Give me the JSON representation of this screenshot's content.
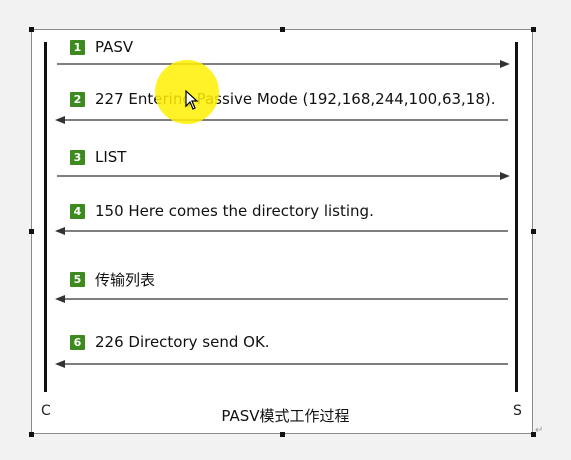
{
  "steps": [
    {
      "num": "1",
      "text": "PASV",
      "dir": "right"
    },
    {
      "num": "2",
      "text": "227 Entering Passive Mode (192,168,244,100,63,18).",
      "dir": "left"
    },
    {
      "num": "3",
      "text": "LIST",
      "dir": "right"
    },
    {
      "num": "4",
      "text": "150 Here comes the directory listing.",
      "dir": "left"
    },
    {
      "num": "5",
      "text": "传输列表",
      "dir": "left"
    },
    {
      "num": "6",
      "text": "226 Directory send OK.",
      "dir": "left"
    }
  ],
  "client_label": "C",
  "server_label": "S",
  "caption": "PASV模式工作过程",
  "colors": {
    "badge": "#3d8b1e",
    "highlight": "#fff000",
    "line": "#111111"
  },
  "icons": {
    "cursor": "mouse-pointer-icon"
  }
}
